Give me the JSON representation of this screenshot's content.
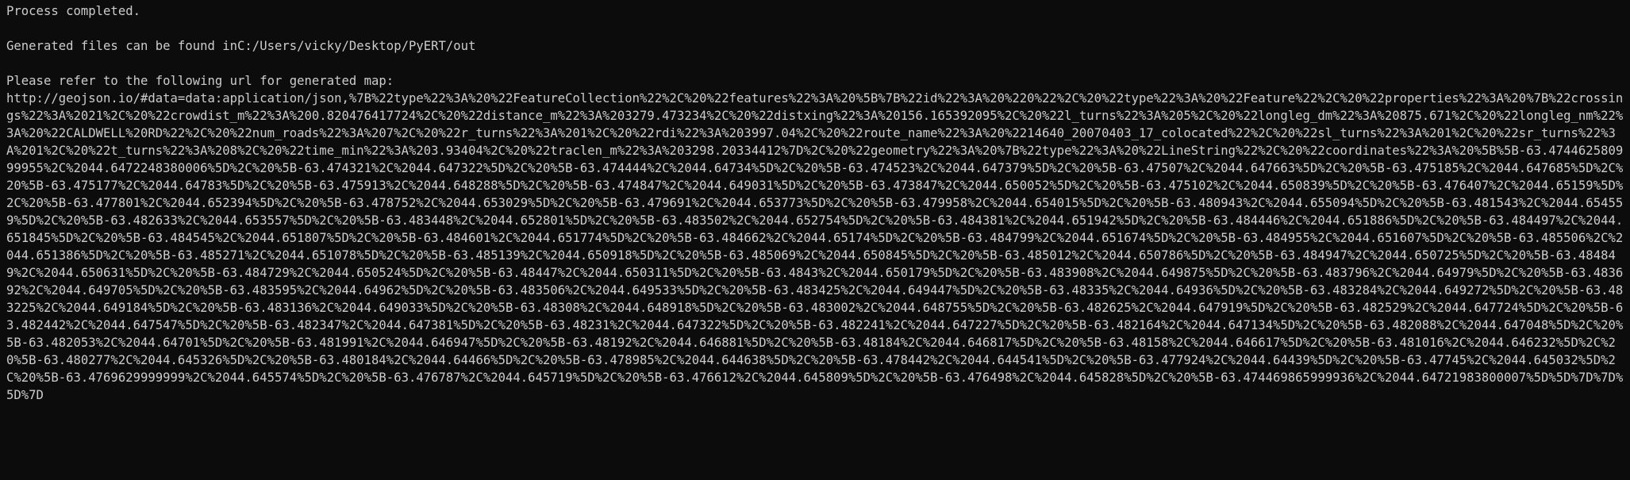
{
  "terminal": {
    "status_line": "Process completed.",
    "files_line": "Generated files can be found inC:/Users/vicky/Desktop/PyERT/out",
    "map_prompt": "Please refer to the following url for generated map:",
    "url": "http://geojson.io/#data=data:application/json,%7B%22type%22%3A%20%22FeatureCollection%22%2C%20%22features%22%3A%20%5B%7B%22id%22%3A%20%220%22%2C%20%22type%22%3A%20%22Feature%22%2C%20%22properties%22%3A%20%7B%22crossings%22%3A%2021%2C%20%22crowdist_m%22%3A%200.820476417724%2C%20%22distance_m%22%3A%203279.473234%2C%20%22distxing%22%3A%20156.165392095%2C%20%22l_turns%22%3A%205%2C%20%22longleg_dm%22%3A%20875.671%2C%20%22longleg_nm%22%3A%20%22CALDWELL%20RD%22%2C%20%22num_roads%22%3A%207%2C%20%22r_turns%22%3A%201%2C%20%22rdi%22%3A%203997.04%2C%20%22route_name%22%3A%20%2214640_20070403_17_colocated%22%2C%20%22sl_turns%22%3A%201%2C%20%22sr_turns%22%3A%201%2C%20%22t_turns%22%3A%208%2C%20%22time_min%22%3A%203.93404%2C%20%22traclen_m%22%3A%203298.20334412%7D%2C%20%22geometry%22%3A%20%7B%22type%22%3A%20%22LineString%22%2C%20%22coordinates%22%3A%20%5B%5B-63.474462580999955%2C%2044.6472248380006%5D%2C%20%5B-63.474321%2C%2044.647322%5D%2C%20%5B-63.474444%2C%2044.64734%5D%2C%20%5B-63.474523%2C%2044.647379%5D%2C%20%5B-63.47507%2C%2044.647663%5D%2C%20%5B-63.475185%2C%2044.647685%5D%2C%20%5B-63.475177%2C%2044.64783%5D%2C%20%5B-63.475913%2C%2044.648288%5D%2C%20%5B-63.474847%2C%2044.649031%5D%2C%20%5B-63.473847%2C%2044.650052%5D%2C%20%5B-63.475102%2C%2044.650839%5D%2C%20%5B-63.476407%2C%2044.65159%5D%2C%20%5B-63.477801%2C%2044.652394%5D%2C%20%5B-63.478752%2C%2044.653029%5D%2C%20%5B-63.479691%2C%2044.653773%5D%2C%20%5B-63.479958%2C%2044.654015%5D%2C%20%5B-63.480943%2C%2044.655094%5D%2C%20%5B-63.481543%2C%2044.654559%5D%2C%20%5B-63.482633%2C%2044.653557%5D%2C%20%5B-63.483448%2C%2044.652801%5D%2C%20%5B-63.483502%2C%2044.652754%5D%2C%20%5B-63.484381%2C%2044.651942%5D%2C%20%5B-63.484446%2C%2044.651886%5D%2C%20%5B-63.484497%2C%2044.651845%5D%2C%20%5B-63.484545%2C%2044.651807%5D%2C%20%5B-63.484601%2C%2044.651774%5D%2C%20%5B-63.484662%2C%2044.65174%5D%2C%20%5B-63.484799%2C%2044.651674%5D%2C%20%5B-63.484955%2C%2044.651607%5D%2C%20%5B-63.485506%2C%2044.651386%5D%2C%20%5B-63.485271%2C%2044.651078%5D%2C%20%5B-63.485139%2C%2044.650918%5D%2C%20%5B-63.485069%2C%2044.650845%5D%2C%20%5B-63.485012%2C%2044.650786%5D%2C%20%5B-63.484947%2C%2044.650725%5D%2C%20%5B-63.484849%2C%2044.650631%5D%2C%20%5B-63.484729%2C%2044.650524%5D%2C%20%5B-63.48447%2C%2044.650311%5D%2C%20%5B-63.4843%2C%2044.650179%5D%2C%20%5B-63.483908%2C%2044.649875%5D%2C%20%5B-63.483796%2C%2044.64979%5D%2C%20%5B-63.483692%2C%2044.649705%5D%2C%20%5B-63.483595%2C%2044.64962%5D%2C%20%5B-63.483506%2C%2044.649533%5D%2C%20%5B-63.483425%2C%2044.649447%5D%2C%20%5B-63.48335%2C%2044.64936%5D%2C%20%5B-63.483284%2C%2044.649272%5D%2C%20%5B-63.483225%2C%2044.649184%5D%2C%20%5B-63.483136%2C%2044.649033%5D%2C%20%5B-63.48308%2C%2044.648918%5D%2C%20%5B-63.483002%2C%2044.648755%5D%2C%20%5B-63.482625%2C%2044.647919%5D%2C%20%5B-63.482529%2C%2044.647724%5D%2C%20%5B-63.482442%2C%2044.647547%5D%2C%20%5B-63.482347%2C%2044.647381%5D%2C%20%5B-63.48231%2C%2044.647322%5D%2C%20%5B-63.482241%2C%2044.647227%5D%2C%20%5B-63.482164%2C%2044.647134%5D%2C%20%5B-63.482088%2C%2044.647048%5D%2C%20%5B-63.482053%2C%2044.64701%5D%2C%20%5B-63.481991%2C%2044.646947%5D%2C%20%5B-63.48192%2C%2044.646881%5D%2C%20%5B-63.48184%2C%2044.646817%5D%2C%20%5B-63.48158%2C%2044.646617%5D%2C%20%5B-63.481016%2C%2044.646232%5D%2C%20%5B-63.480277%2C%2044.645326%5D%2C%20%5B-63.480184%2C%2044.64466%5D%2C%20%5B-63.478985%2C%2044.644638%5D%2C%20%5B-63.478442%2C%2044.644541%5D%2C%20%5B-63.477924%2C%2044.64439%5D%2C%20%5B-63.47745%2C%2044.645032%5D%2C%20%5B-63.4769629999999%2C%2044.645574%5D%2C%20%5B-63.476787%2C%2044.645719%5D%2C%20%5B-63.476612%2C%2044.645809%5D%2C%20%5B-63.476498%2C%2044.645828%5D%2C%20%5B-63.474469865999936%2C%2044.64721983800007%5D%5D%7D%7D%5D%7D"
  }
}
